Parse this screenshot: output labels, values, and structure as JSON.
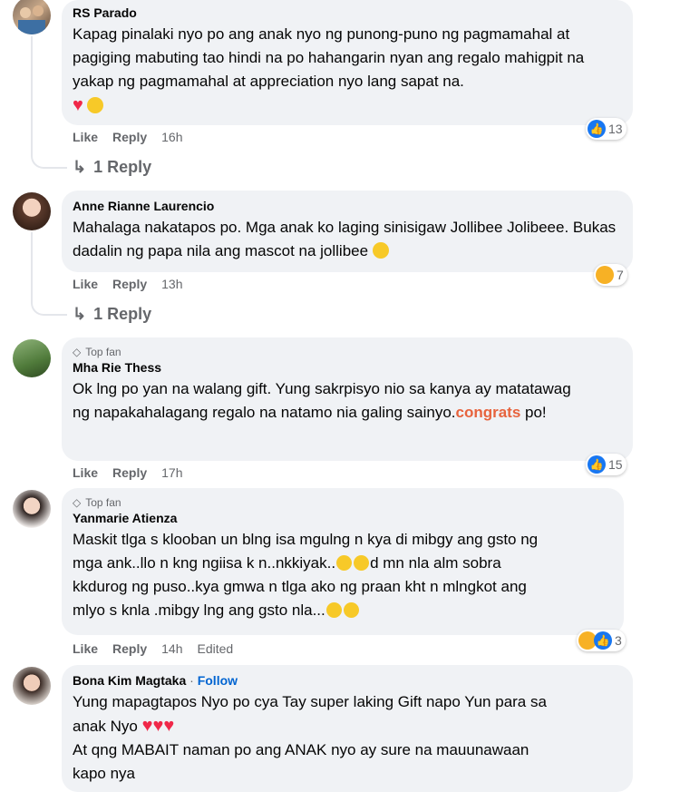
{
  "comments": [
    {
      "name": "RS Parado",
      "text": "Kapag pinalaki nyo po ang anak nyo ng punong-puno ng pagmamahal at pagiging mabuting tao hindi na po hahangarin nyan ang regalo mahigpit na yakap ng pagmamahal at appreciation nyo lang sapat na.",
      "like": "Like",
      "reply": "Reply",
      "time": "16h",
      "reaction_count": "13",
      "replies": "1 Reply"
    },
    {
      "name": "Anne Rianne Laurencio",
      "text": "Mahalaga nakatapos po. Mga anak ko laging sinisigaw Jollibee Jolibeee. Bukas dadalin ng papa nila ang mascot na jollibee",
      "like": "Like",
      "reply": "Reply",
      "time": "13h",
      "reaction_count": "7",
      "replies": "1 Reply"
    },
    {
      "badge": "Top fan",
      "name": "Mha Rie Thess",
      "text_before": "Ok lng po yan na walang gift. Yung sakrpisyo nio sa kanya ay matatawag ng napakahalagang regalo na natamo nia galing sainyo.",
      "highlight": "congrats",
      "text_after": " po!",
      "like": "Like",
      "reply": "Reply",
      "time": "17h",
      "reaction_count": "15"
    },
    {
      "badge": "Top fan",
      "name": "Yanmarie Atienza",
      "line1": "Maskit tlga s klooban un blng isa mgulng n kya di mibgy ang gsto ng",
      "line2": "mga ank..llo n kng ngiisa k n..nkkiyak..",
      "line2b": "d mn nla alm sobra",
      "line3": "kkdurog ng puso..kya gmwa n tlga ako ng praan kht n mlngkot ang",
      "line4": "mlyo s knla .mibgy lng ang gsto nla...",
      "like": "Like",
      "reply": "Reply",
      "time": "14h",
      "edited": "Edited",
      "reaction_count": "3"
    },
    {
      "name": "Bona Kim Magtaka",
      "follow": "Follow",
      "line1": "Yung mapagtapos Nyo po cya Tay super laking Gift napo Yun para sa",
      "line2": "anak Nyo",
      "line3": "At qng MABAIT naman po ang ANAK nyo ay sure na mauunawaan",
      "line4": "kapo nya"
    }
  ],
  "colors": {
    "bubble": "#f0f2f5",
    "like_blue": "#1877f2",
    "follow": "#0064d1",
    "congrats": "#e7633d"
  }
}
